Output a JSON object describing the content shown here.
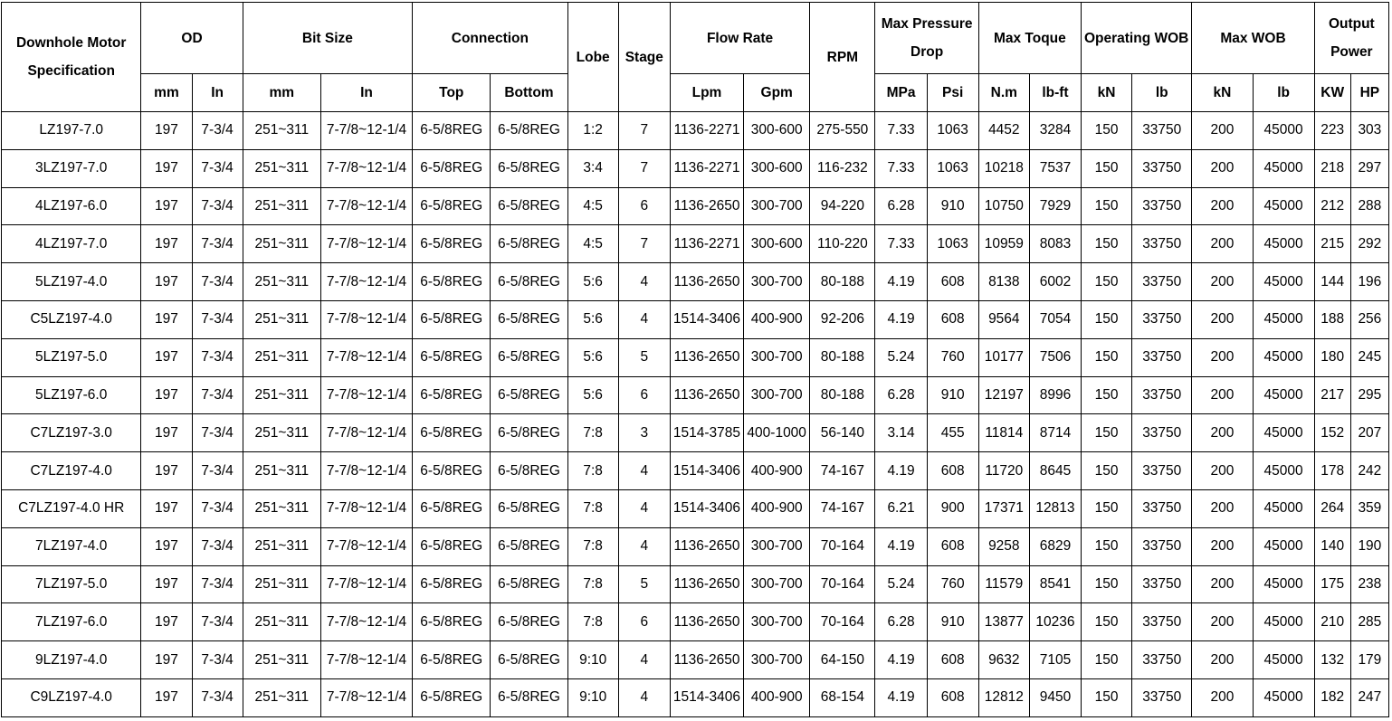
{
  "headers": {
    "spec": "Downhole Motor Specification",
    "od": "OD",
    "bit_size": "Bit Size",
    "connection": "Connection",
    "lobe": "Lobe",
    "stage": "Stage",
    "flow_rate": "Flow Rate",
    "rpm": "RPM",
    "max_pressure_drop": "Max Pressure Drop",
    "max_toque": "Max Toque",
    "operating_wob": "Operating WOB",
    "max_wob": "Max WOB",
    "output_power": "Output Power"
  },
  "subheaders": [
    "mm",
    "In",
    "mm",
    "In",
    "Top",
    "Bottom",
    "Lpm",
    "Gpm",
    "MPa",
    "Psi",
    "N.m",
    "lb-ft",
    "kN",
    "lb",
    "kN",
    "lb",
    "KW",
    "HP"
  ],
  "rows": [
    [
      "LZ197-7.0",
      "197",
      "7-3/4",
      "251~311",
      "7-7/8~12-1/4",
      "6-5/8REG",
      "6-5/8REG",
      "1:2",
      "7",
      "1136-2271",
      "300-600",
      "275-550",
      "7.33",
      "1063",
      "4452",
      "3284",
      "150",
      "33750",
      "200",
      "45000",
      "223",
      "303"
    ],
    [
      "3LZ197-7.0",
      "197",
      "7-3/4",
      "251~311",
      "7-7/8~12-1/4",
      "6-5/8REG",
      "6-5/8REG",
      "3:4",
      "7",
      "1136-2271",
      "300-600",
      "116-232",
      "7.33",
      "1063",
      "10218",
      "7537",
      "150",
      "33750",
      "200",
      "45000",
      "218",
      "297"
    ],
    [
      "4LZ197-6.0",
      "197",
      "7-3/4",
      "251~311",
      "7-7/8~12-1/4",
      "6-5/8REG",
      "6-5/8REG",
      "4:5",
      "6",
      "1136-2650",
      "300-700",
      "94-220",
      "6.28",
      "910",
      "10750",
      "7929",
      "150",
      "33750",
      "200",
      "45000",
      "212",
      "288"
    ],
    [
      "4LZ197-7.0",
      "197",
      "7-3/4",
      "251~311",
      "7-7/8~12-1/4",
      "6-5/8REG",
      "6-5/8REG",
      "4:5",
      "7",
      "1136-2271",
      "300-600",
      "110-220",
      "7.33",
      "1063",
      "10959",
      "8083",
      "150",
      "33750",
      "200",
      "45000",
      "215",
      "292"
    ],
    [
      "5LZ197-4.0",
      "197",
      "7-3/4",
      "251~311",
      "7-7/8~12-1/4",
      "6-5/8REG",
      "6-5/8REG",
      "5:6",
      "4",
      "1136-2650",
      "300-700",
      "80-188",
      "4.19",
      "608",
      "8138",
      "6002",
      "150",
      "33750",
      "200",
      "45000",
      "144",
      "196"
    ],
    [
      "C5LZ197-4.0",
      "197",
      "7-3/4",
      "251~311",
      "7-7/8~12-1/4",
      "6-5/8REG",
      "6-5/8REG",
      "5:6",
      "4",
      "1514-3406",
      "400-900",
      "92-206",
      "4.19",
      "608",
      "9564",
      "7054",
      "150",
      "33750",
      "200",
      "45000",
      "188",
      "256"
    ],
    [
      "5LZ197-5.0",
      "197",
      "7-3/4",
      "251~311",
      "7-7/8~12-1/4",
      "6-5/8REG",
      "6-5/8REG",
      "5:6",
      "5",
      "1136-2650",
      "300-700",
      "80-188",
      "5.24",
      "760",
      "10177",
      "7506",
      "150",
      "33750",
      "200",
      "45000",
      "180",
      "245"
    ],
    [
      "5LZ197-6.0",
      "197",
      "7-3/4",
      "251~311",
      "7-7/8~12-1/4",
      "6-5/8REG",
      "6-5/8REG",
      "5:6",
      "6",
      "1136-2650",
      "300-700",
      "80-188",
      "6.28",
      "910",
      "12197",
      "8996",
      "150",
      "33750",
      "200",
      "45000",
      "217",
      "295"
    ],
    [
      "C7LZ197-3.0",
      "197",
      "7-3/4",
      "251~311",
      "7-7/8~12-1/4",
      "6-5/8REG",
      "6-5/8REG",
      "7:8",
      "3",
      "1514-3785",
      "400-1000",
      "56-140",
      "3.14",
      "455",
      "11814",
      "8714",
      "150",
      "33750",
      "200",
      "45000",
      "152",
      "207"
    ],
    [
      "C7LZ197-4.0",
      "197",
      "7-3/4",
      "251~311",
      "7-7/8~12-1/4",
      "6-5/8REG",
      "6-5/8REG",
      "7:8",
      "4",
      "1514-3406",
      "400-900",
      "74-167",
      "4.19",
      "608",
      "11720",
      "8645",
      "150",
      "33750",
      "200",
      "45000",
      "178",
      "242"
    ],
    [
      "C7LZ197-4.0 HR",
      "197",
      "7-3/4",
      "251~311",
      "7-7/8~12-1/4",
      "6-5/8REG",
      "6-5/8REG",
      "7:8",
      "4",
      "1514-3406",
      "400-900",
      "74-167",
      "6.21",
      "900",
      "17371",
      "12813",
      "150",
      "33750",
      "200",
      "45000",
      "264",
      "359"
    ],
    [
      "7LZ197-4.0",
      "197",
      "7-3/4",
      "251~311",
      "7-7/8~12-1/4",
      "6-5/8REG",
      "6-5/8REG",
      "7:8",
      "4",
      "1136-2650",
      "300-700",
      "70-164",
      "4.19",
      "608",
      "9258",
      "6829",
      "150",
      "33750",
      "200",
      "45000",
      "140",
      "190"
    ],
    [
      "7LZ197-5.0",
      "197",
      "7-3/4",
      "251~311",
      "7-7/8~12-1/4",
      "6-5/8REG",
      "6-5/8REG",
      "7:8",
      "5",
      "1136-2650",
      "300-700",
      "70-164",
      "5.24",
      "760",
      "11579",
      "8541",
      "150",
      "33750",
      "200",
      "45000",
      "175",
      "238"
    ],
    [
      "7LZ197-6.0",
      "197",
      "7-3/4",
      "251~311",
      "7-7/8~12-1/4",
      "6-5/8REG",
      "6-5/8REG",
      "7:8",
      "6",
      "1136-2650",
      "300-700",
      "70-164",
      "6.28",
      "910",
      "13877",
      "10236",
      "150",
      "33750",
      "200",
      "45000",
      "210",
      "285"
    ],
    [
      "9LZ197-4.0",
      "197",
      "7-3/4",
      "251~311",
      "7-7/8~12-1/4",
      "6-5/8REG",
      "6-5/8REG",
      "9:10",
      "4",
      "1136-2650",
      "300-700",
      "64-150",
      "4.19",
      "608",
      "9632",
      "7105",
      "150",
      "33750",
      "200",
      "45000",
      "132",
      "179"
    ],
    [
      "C9LZ197-4.0",
      "197",
      "7-3/4",
      "251~311",
      "7-7/8~12-1/4",
      "6-5/8REG",
      "6-5/8REG",
      "9:10",
      "4",
      "1514-3406",
      "400-900",
      "68-154",
      "4.19",
      "608",
      "12812",
      "9450",
      "150",
      "33750",
      "200",
      "45000",
      "182",
      "247"
    ]
  ]
}
